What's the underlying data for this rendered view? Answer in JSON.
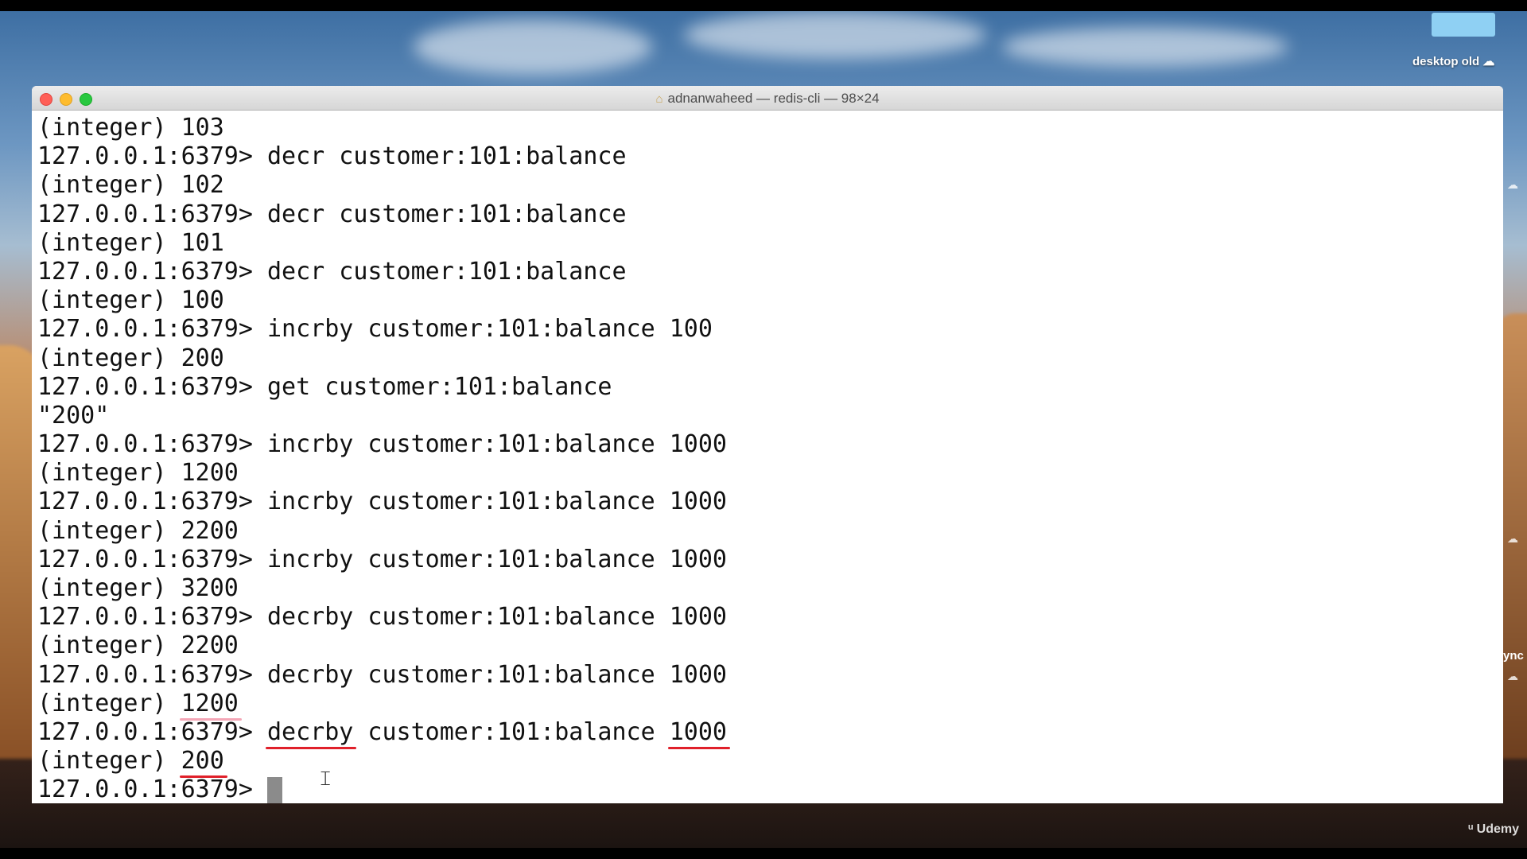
{
  "desktop": {
    "label": "desktop old",
    "sync_label": "ync",
    "watermark": "Udemy"
  },
  "window": {
    "title": "adnanwaheed — redis-cli — 98×24"
  },
  "terminal": {
    "prompt": "127.0.0.1:6379>",
    "lines": [
      "(integer) 103",
      "127.0.0.1:6379> decr customer:101:balance",
      "(integer) 102",
      "127.0.0.1:6379> decr customer:101:balance",
      "(integer) 101",
      "127.0.0.1:6379> decr customer:101:balance",
      "(integer) 100",
      "127.0.0.1:6379> incrby customer:101:balance 100",
      "(integer) 200",
      "127.0.0.1:6379> get customer:101:balance",
      "\"200\"",
      "127.0.0.1:6379> incrby customer:101:balance 1000",
      "(integer) 1200",
      "127.0.0.1:6379> incrby customer:101:balance 1000",
      "(integer) 2200",
      "127.0.0.1:6379> incrby customer:101:balance 1000",
      "(integer) 3200",
      "127.0.0.1:6379> decrby customer:101:balance 1000",
      "(integer) 2200",
      "127.0.0.1:6379> decrby customer:101:balance 1000"
    ],
    "highlight_block": {
      "result_prefix": "(integer) ",
      "result_1200": "1200",
      "cmd_prompt": "127.0.0.1:6379> ",
      "cmd_decrby": "decrby",
      "cmd_key": " customer:101:balance ",
      "cmd_amount": "1000",
      "result_200": "200"
    }
  }
}
